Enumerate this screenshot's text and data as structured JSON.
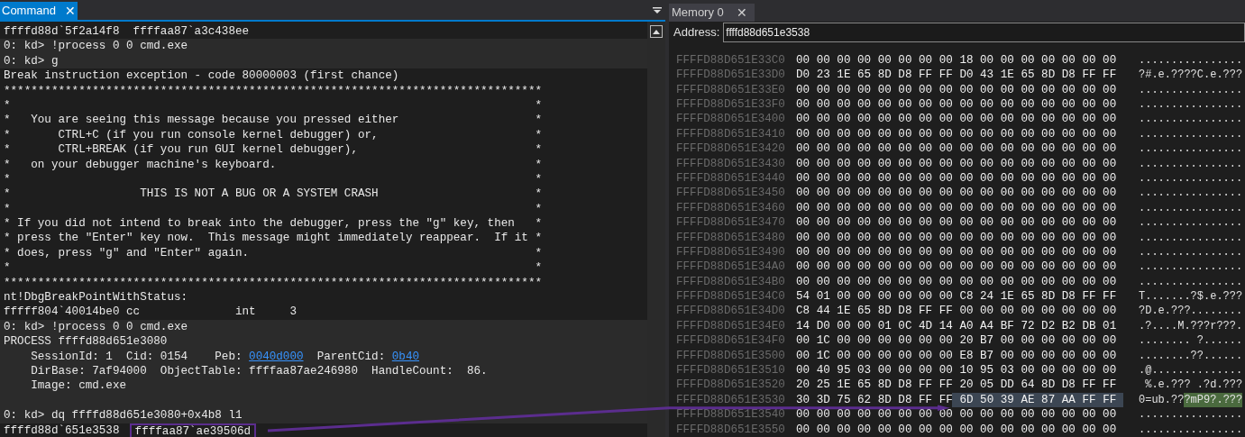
{
  "command_pane": {
    "tab": {
      "label": "Command",
      "close": "✕",
      "selected": true
    },
    "lines": [
      {
        "shaded": false,
        "text": "ffffd88d`5f2a14f8  ffffaa87`a3c438ee"
      },
      {
        "shaded": true,
        "text": "0: kd> !process 0 0 cmd.exe"
      },
      {
        "shaded": true,
        "text": "0: kd> g"
      },
      {
        "shaded": false,
        "text": "Break instruction exception - code 80000003 (first chance)"
      },
      {
        "shaded": false,
        "text": "*******************************************************************************"
      },
      {
        "shaded": false,
        "text": "*                                                                             *"
      },
      {
        "shaded": false,
        "text": "*   You are seeing this message because you pressed either                    *"
      },
      {
        "shaded": false,
        "text": "*       CTRL+C (if you run console kernel debugger) or,                       *"
      },
      {
        "shaded": false,
        "text": "*       CTRL+BREAK (if you run GUI kernel debugger),                          *"
      },
      {
        "shaded": false,
        "text": "*   on your debugger machine's keyboard.                                      *"
      },
      {
        "shaded": false,
        "text": "*                                                                             *"
      },
      {
        "shaded": false,
        "text": "*                   THIS IS NOT A BUG OR A SYSTEM CRASH                       *"
      },
      {
        "shaded": false,
        "text": "*                                                                             *"
      },
      {
        "shaded": false,
        "text": "* If you did not intend to break into the debugger, press the \"g\" key, then   *"
      },
      {
        "shaded": false,
        "text": "* press the \"Enter\" key now.  This message might immediately reappear.  If it *"
      },
      {
        "shaded": false,
        "text": "* does, press \"g\" and \"Enter\" again.                                          *"
      },
      {
        "shaded": false,
        "parts": [
          {
            "kind": "edge",
            "text": "*"
          },
          {
            "kind": "far_edge",
            "text": "*"
          }
        ]
      },
      {
        "shaded": false,
        "text": "*******************************************************************************"
      },
      {
        "shaded": false,
        "text": "nt!DbgBreakPointWithStatus:"
      },
      {
        "shaded": false,
        "text": "fffff804`40014be0 cc              int     3"
      },
      {
        "shaded": true,
        "text": "0: kd> !process 0 0 cmd.exe"
      },
      {
        "shaded": true,
        "text": "PROCESS ffffd88d651e3080"
      },
      {
        "shaded": true,
        "parts": [
          {
            "kind": "text",
            "text": "    SessionId: 1  Cid: 0154    Peb: "
          },
          {
            "kind": "link",
            "text": "0040d000"
          },
          {
            "kind": "text",
            "text": "  ParentCid: "
          },
          {
            "kind": "link",
            "text": "0b40"
          }
        ]
      },
      {
        "shaded": true,
        "text": "    DirBase: 7af94000  ObjectTable: ffffaa87ae246980  HandleCount:  86."
      },
      {
        "shaded": true,
        "text": "    Image: cmd.exe"
      },
      {
        "shaded": true
      },
      {
        "shaded": true,
        "text": "0: kd> dq ffffd88d651e3080+0x4b8 l1"
      },
      {
        "shaded": false,
        "parts": [
          {
            "kind": "text",
            "text": "ffffd88d`651e3538  "
          },
          {
            "kind": "framed",
            "text": "ffffaa87`ae39506d"
          }
        ]
      }
    ]
  },
  "memory_pane": {
    "tab": {
      "label": "Memory 0",
      "close": "✕",
      "selected": false
    },
    "address_label": "Address:",
    "address_value": "ffffd88d651e3538",
    "rows": [
      {
        "address": "FFFFD88D651E33C0",
        "bytes": [
          {
            "text": "00 00 00 00 00 00 00 00 18 00 00 00 00 00 00 00",
            "selected": false
          }
        ],
        "ascii": [
          {
            "text": "................",
            "selected": false
          }
        ]
      },
      {
        "address": "FFFFD88D651E33D0",
        "bytes": [
          {
            "text": "D0 23 1E 65 8D D8 FF FF D0 43 1E 65 8D D8 FF FF",
            "selected": false
          }
        ],
        "ascii": [
          {
            "text": "?#.e.????C.e.???",
            "selected": false
          }
        ]
      },
      {
        "address": "FFFFD88D651E33E0",
        "bytes": [
          {
            "text": "00 00 00 00 00 00 00 00 00 00 00 00 00 00 00 00",
            "selected": false
          }
        ],
        "ascii": [
          {
            "text": "................",
            "selected": false
          }
        ]
      },
      {
        "address": "FFFFD88D651E33F0",
        "bytes": [
          {
            "text": "00 00 00 00 00 00 00 00 00 00 00 00 00 00 00 00",
            "selected": false
          }
        ],
        "ascii": [
          {
            "text": "................",
            "selected": false
          }
        ]
      },
      {
        "address": "FFFFD88D651E3400",
        "bytes": [
          {
            "text": "00 00 00 00 00 00 00 00 00 00 00 00 00 00 00 00",
            "selected": false
          }
        ],
        "ascii": [
          {
            "text": "................",
            "selected": false
          }
        ]
      },
      {
        "address": "FFFFD88D651E3410",
        "bytes": [
          {
            "text": "00 00 00 00 00 00 00 00 00 00 00 00 00 00 00 00",
            "selected": false
          }
        ],
        "ascii": [
          {
            "text": "................",
            "selected": false
          }
        ]
      },
      {
        "address": "FFFFD88D651E3420",
        "bytes": [
          {
            "text": "00 00 00 00 00 00 00 00 00 00 00 00 00 00 00 00",
            "selected": false
          }
        ],
        "ascii": [
          {
            "text": "................",
            "selected": false
          }
        ]
      },
      {
        "address": "FFFFD88D651E3430",
        "bytes": [
          {
            "text": "00 00 00 00 00 00 00 00 00 00 00 00 00 00 00 00",
            "selected": false
          }
        ],
        "ascii": [
          {
            "text": "................",
            "selected": false
          }
        ]
      },
      {
        "address": "FFFFD88D651E3440",
        "bytes": [
          {
            "text": "00 00 00 00 00 00 00 00 00 00 00 00 00 00 00 00",
            "selected": false
          }
        ],
        "ascii": [
          {
            "text": "................",
            "selected": false
          }
        ]
      },
      {
        "address": "FFFFD88D651E3450",
        "bytes": [
          {
            "text": "00 00 00 00 00 00 00 00 00 00 00 00 00 00 00 00",
            "selected": false
          }
        ],
        "ascii": [
          {
            "text": "................",
            "selected": false
          }
        ]
      },
      {
        "address": "FFFFD88D651E3460",
        "bytes": [
          {
            "text": "00 00 00 00 00 00 00 00 00 00 00 00 00 00 00 00",
            "selected": false
          }
        ],
        "ascii": [
          {
            "text": "................",
            "selected": false
          }
        ]
      },
      {
        "address": "FFFFD88D651E3470",
        "bytes": [
          {
            "text": "00 00 00 00 00 00 00 00 00 00 00 00 00 00 00 00",
            "selected": false
          }
        ],
        "ascii": [
          {
            "text": "................",
            "selected": false
          }
        ]
      },
      {
        "address": "FFFFD88D651E3480",
        "bytes": [
          {
            "text": "00 00 00 00 00 00 00 00 00 00 00 00 00 00 00 00",
            "selected": false
          }
        ],
        "ascii": [
          {
            "text": "................",
            "selected": false
          }
        ]
      },
      {
        "address": "FFFFD88D651E3490",
        "bytes": [
          {
            "text": "00 00 00 00 00 00 00 00 00 00 00 00 00 00 00 00",
            "selected": false
          }
        ],
        "ascii": [
          {
            "text": "................",
            "selected": false
          }
        ]
      },
      {
        "address": "FFFFD88D651E34A0",
        "bytes": [
          {
            "text": "00 00 00 00 00 00 00 00 00 00 00 00 00 00 00 00",
            "selected": false
          }
        ],
        "ascii": [
          {
            "text": "................",
            "selected": false
          }
        ]
      },
      {
        "address": "FFFFD88D651E34B0",
        "bytes": [
          {
            "text": "00 00 00 00 00 00 00 00 00 00 00 00 00 00 00 00",
            "selected": false
          }
        ],
        "ascii": [
          {
            "text": "................",
            "selected": false
          }
        ]
      },
      {
        "address": "FFFFD88D651E34C0",
        "bytes": [
          {
            "text": "54 01 00 00 00 00 00 00 C8 24 1E 65 8D D8 FF FF",
            "selected": false
          }
        ],
        "ascii": [
          {
            "text": "T.......?$.e.???",
            "selected": false
          }
        ]
      },
      {
        "address": "FFFFD88D651E34D0",
        "bytes": [
          {
            "text": "C8 44 1E 65 8D D8 FF FF 00 00 00 00 00 00 00 00",
            "selected": false
          }
        ],
        "ascii": [
          {
            "text": "?D.e.???........",
            "selected": false
          }
        ]
      },
      {
        "address": "FFFFD88D651E34E0",
        "bytes": [
          {
            "text": "14 D0 00 00 01 0C 4D 14 A0 A4 BF 72 D2 B2 DB 01",
            "selected": false
          }
        ],
        "ascii": [
          {
            "text": ".?....M.???r???.",
            "selected": false
          }
        ]
      },
      {
        "address": "FFFFD88D651E34F0",
        "bytes": [
          {
            "text": "00 1C 00 00 00 00 00 00 20 B7 00 00 00 00 00 00",
            "selected": false
          }
        ],
        "ascii": [
          {
            "text": "........ ?......",
            "selected": false
          }
        ]
      },
      {
        "address": "FFFFD88D651E3500",
        "bytes": [
          {
            "text": "00 1C 00 00 00 00 00 00 E8 B7 00 00 00 00 00 00",
            "selected": false
          }
        ],
        "ascii": [
          {
            "text": "........??......",
            "selected": false
          }
        ]
      },
      {
        "address": "FFFFD88D651E3510",
        "bytes": [
          {
            "text": "00 40 95 03 00 00 00 00 10 95 03 00 00 00 00 00",
            "selected": false
          }
        ],
        "ascii": [
          {
            "text": ".@..............",
            "selected": false
          }
        ]
      },
      {
        "address": "FFFFD88D651E3520",
        "bytes": [
          {
            "text": "20 25 1E 65 8D D8 FF FF 20 05 DD 64 8D D8 FF FF",
            "selected": false
          }
        ],
        "ascii": [
          {
            "text": " %.e.??? .?d.???",
            "selected": false
          }
        ]
      },
      {
        "address": "FFFFD88D651E3530",
        "bytes": [
          {
            "text": "30 3D 75 62 8D D8 FF FF",
            "selected": false
          },
          {
            "text": "6D 50 39 AE 87 AA FF FF",
            "selected": true
          }
        ],
        "ascii": [
          {
            "text": "0=ub.??",
            "selected": false
          },
          {
            "text": "?mP9?.???",
            "selected": true
          }
        ]
      },
      {
        "address": "FFFFD88D651E3540",
        "bytes": [
          {
            "text": "00 00 00 00 00 00 00 00 00 00 00 00 00 00 00 00",
            "selected": false
          }
        ],
        "ascii": [
          {
            "text": "................",
            "selected": false
          }
        ]
      },
      {
        "address": "FFFFD88D651E3550",
        "bytes": [
          {
            "text": "00 00 00 00 00 00 00 00 00 00 00 00 00 00 00 00",
            "selected": false
          }
        ],
        "ascii": [
          {
            "text": "................",
            "selected": false
          }
        ]
      }
    ]
  }
}
